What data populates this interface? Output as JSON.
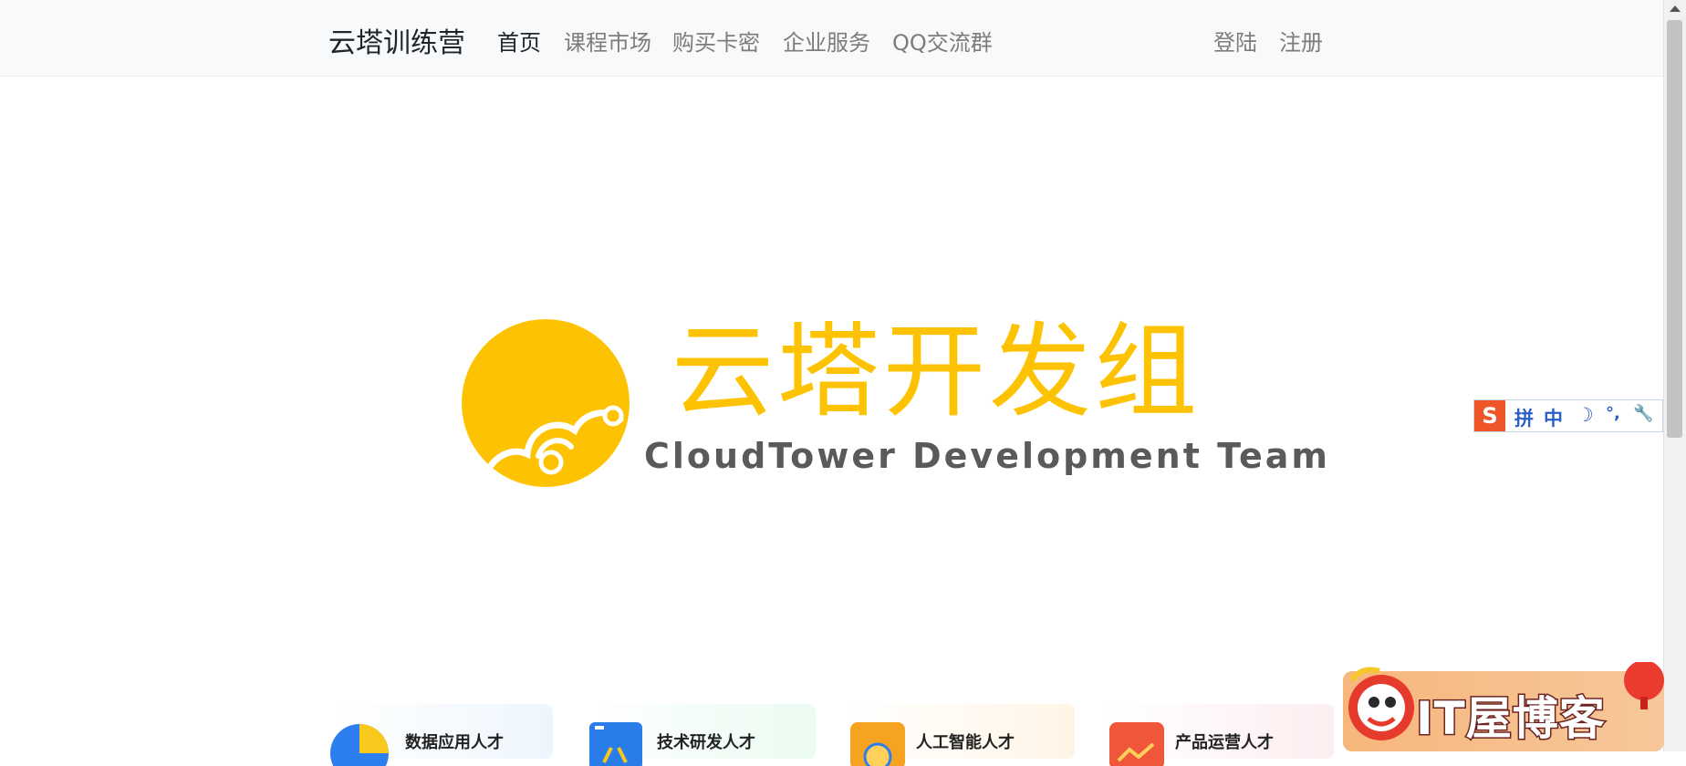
{
  "navbar": {
    "brand": "云塔训练营",
    "links": [
      "首页",
      "课程市场",
      "购买卡密",
      "企业服务",
      "QQ交流群"
    ],
    "auth": [
      "登陆",
      "注册"
    ]
  },
  "hero": {
    "title": "云塔开发组",
    "subtitle": "CloudTower Development Team",
    "brand_color": "#fdc302"
  },
  "cards": [
    {
      "label": "数据应用人才",
      "icon": "pie-chart-icon"
    },
    {
      "label": "技术研发人才",
      "icon": "code-window-icon"
    },
    {
      "label": "人工智能人才",
      "icon": "ai-chip-icon"
    },
    {
      "label": "产品运营人才",
      "icon": "trend-chart-icon"
    }
  ],
  "ime_toolbar": {
    "logo": "S",
    "items": [
      "拼",
      "中",
      "☽",
      "°,",
      "🔧"
    ]
  },
  "blog_banner": {
    "text": "IT屋博客",
    "icon": "lion-dance-icon"
  }
}
